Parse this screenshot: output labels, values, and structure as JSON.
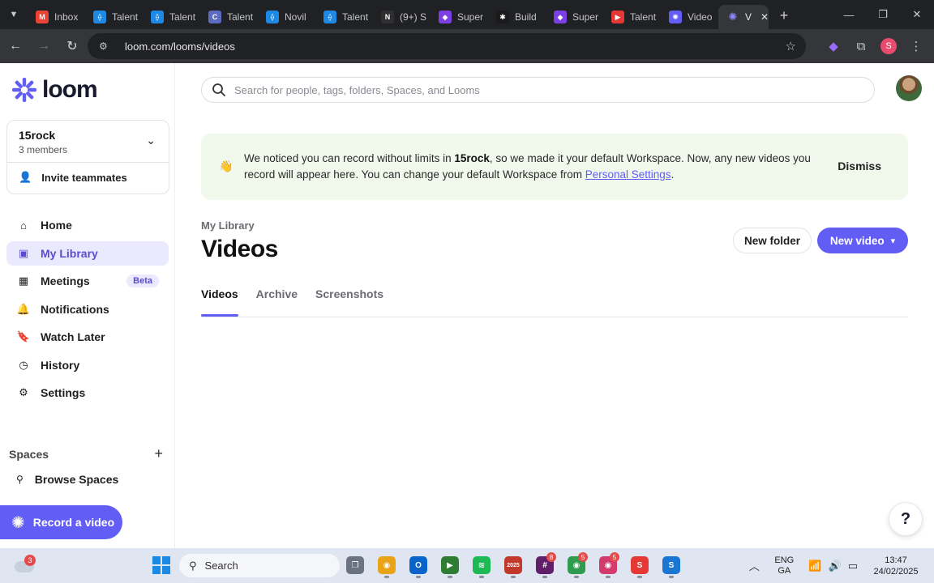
{
  "browser": {
    "tabs": [
      {
        "label": "Inbox",
        "icon": "gmail-icon",
        "color": "#ea4335",
        "glyph": "M"
      },
      {
        "label": "Talent",
        "icon": "talent-icon",
        "color": "#1e88e5",
        "glyph": "⟠"
      },
      {
        "label": "Talent",
        "icon": "talent-icon",
        "color": "#1e88e5",
        "glyph": "⟠"
      },
      {
        "label": "Talent",
        "icon": "talent-c-icon",
        "color": "#5c6bc0",
        "glyph": "C"
      },
      {
        "label": "Novil",
        "icon": "talent-icon",
        "color": "#1e88e5",
        "glyph": "⟠"
      },
      {
        "label": "Talent",
        "icon": "talent-icon",
        "color": "#1e88e5",
        "glyph": "⟠"
      },
      {
        "label": "(9+) S",
        "icon": "notion-icon",
        "color": "#2f2f2f",
        "glyph": "N"
      },
      {
        "label": "Super",
        "icon": "super-icon",
        "color": "#7b3fe4",
        "glyph": "◆"
      },
      {
        "label": "Build",
        "icon": "build-icon",
        "color": "#1a1a1a",
        "glyph": "✱"
      },
      {
        "label": "Super",
        "icon": "super-icon",
        "color": "#7b3fe4",
        "glyph": "◆"
      },
      {
        "label": "Talent",
        "icon": "youtube-icon",
        "color": "#e53935",
        "glyph": "▶"
      },
      {
        "label": "Video",
        "icon": "loom-icon",
        "color": "#625df5",
        "glyph": "✺"
      }
    ],
    "active_tab": {
      "label": "V",
      "icon": "loom-icon"
    },
    "url": "loom.com/looms/videos",
    "profile_initial": "S"
  },
  "sidebar": {
    "logo": "loom",
    "workspace": {
      "name": "15rock",
      "members": "3 members",
      "invite": "Invite teammates"
    },
    "nav": [
      {
        "label": "Home",
        "icon": "home-icon",
        "glyph": "⌂",
        "active": false
      },
      {
        "label": "My Library",
        "icon": "library-icon",
        "glyph": "▣",
        "active": true
      },
      {
        "label": "Meetings",
        "icon": "calendar-icon",
        "glyph": "▦",
        "active": false,
        "badge": "Beta"
      },
      {
        "label": "Notifications",
        "icon": "bell-icon",
        "glyph": "🔔",
        "active": false
      },
      {
        "label": "Watch Later",
        "icon": "bookmark-icon",
        "glyph": "🔖",
        "active": false
      },
      {
        "label": "History",
        "icon": "history-icon",
        "glyph": "◷",
        "active": false
      },
      {
        "label": "Settings",
        "icon": "gear-icon",
        "glyph": "⚙",
        "active": false
      }
    ],
    "spaces_label": "Spaces",
    "browse_spaces": "Browse Spaces",
    "record_button": "Record a video"
  },
  "main": {
    "search_placeholder": "Search for people, tags, folders, Spaces, and Looms",
    "banner": {
      "part1": "We noticed you can record without limits in ",
      "workspace": "15rock",
      "part2": ", so we made it your default Workspace. Now, any new videos you record will appear here. You can change your default Workspace from ",
      "link": "Personal Settings",
      "part3": ".",
      "dismiss": "Dismiss"
    },
    "breadcrumb": "My Library",
    "title": "Videos",
    "new_folder": "New folder",
    "new_video": "New video",
    "tabs": [
      {
        "label": "Videos",
        "active": true
      },
      {
        "label": "Archive",
        "active": false
      },
      {
        "label": "Screenshots",
        "active": false
      }
    ],
    "help": "?"
  },
  "taskbar": {
    "weather_badge": "3",
    "search_label": "Search",
    "apps": [
      {
        "icon": "task-view-icon",
        "color": "#6b7280",
        "glyph": "❐",
        "count": ""
      },
      {
        "icon": "chrome-icon",
        "color": "#e8a317",
        "glyph": "◉",
        "count": ""
      },
      {
        "icon": "outlook-icon",
        "color": "#0a64c9",
        "glyph": "O",
        "count": ""
      },
      {
        "icon": "meet-icon",
        "color": "#2e7d32",
        "glyph": "▶",
        "count": ""
      },
      {
        "icon": "spotify-icon",
        "color": "#1db954",
        "glyph": "≋",
        "count": ""
      },
      {
        "icon": "calendar-app-icon",
        "color": "#c0392b",
        "glyph": "2025",
        "count": ""
      },
      {
        "icon": "slack-icon",
        "color": "#611f69",
        "glyph": "#",
        "count": "8"
      },
      {
        "icon": "chrome-profile-icon",
        "color": "#2e9b4f",
        "glyph": "◉",
        "count": "5"
      },
      {
        "icon": "chrome-profile2-icon",
        "color": "#d33b6d",
        "glyph": "◉",
        "count": "5"
      },
      {
        "icon": "smallpdf-icon",
        "color": "#e53935",
        "glyph": "S",
        "count": ""
      },
      {
        "icon": "s-app-icon",
        "color": "#1976d2",
        "glyph": "S",
        "count": ""
      }
    ],
    "lang": "ENG",
    "lang_sub": "GA",
    "time": "13:47",
    "date": "24/02/2025"
  }
}
